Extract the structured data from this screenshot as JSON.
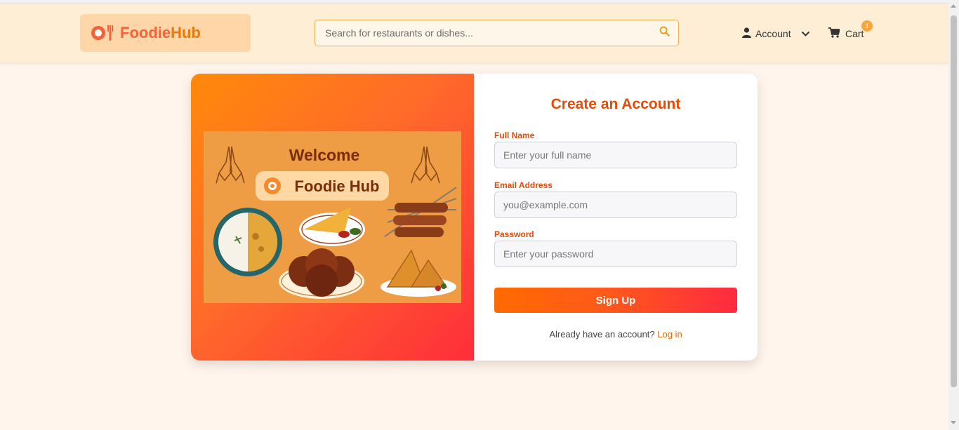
{
  "header": {
    "logo": {
      "part1": "Foodie",
      "part2": "Hub"
    },
    "search": {
      "placeholder": "Search for restaurants or dishes...",
      "icon": "search-icon"
    },
    "account_label": "Account",
    "cart_label": "Cart",
    "cart_count": "1"
  },
  "illustration": {
    "welcome": "Welcome",
    "brand": "Foodie Hub"
  },
  "form": {
    "title": "Create an Account",
    "full_name": {
      "label": "Full Name",
      "placeholder": "Enter your full name"
    },
    "email": {
      "label": "Email Address",
      "placeholder": "you@example.com"
    },
    "password": {
      "label": "Password",
      "placeholder": "Enter your password"
    },
    "submit_label": "Sign Up",
    "login_prompt": "Already have an account?",
    "login_link": "Log in"
  },
  "colors": {
    "accent": "#e84a06",
    "header_bg": "#ffeed6",
    "page_bg": "#fff5ec",
    "button_start": "#ff6a00",
    "button_end": "#ff2a40"
  }
}
